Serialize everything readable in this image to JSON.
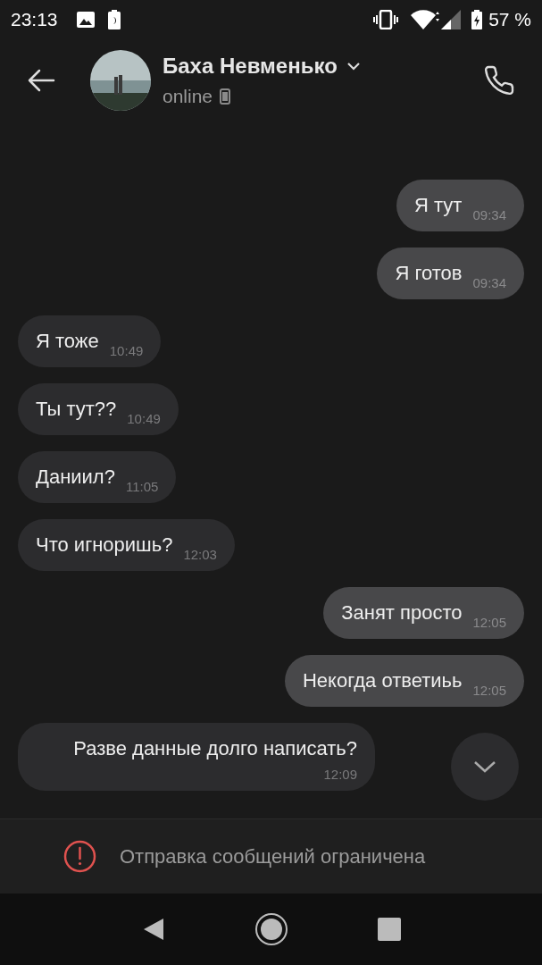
{
  "status_bar": {
    "time": "23:13",
    "battery": "57 %"
  },
  "header": {
    "name": "Баха Невменько",
    "status": "online"
  },
  "messages": [
    {
      "kind": "outgoing",
      "text": "Я тут",
      "time": "09:34"
    },
    {
      "kind": "outgoing",
      "text": "Я готов",
      "time": "09:34"
    },
    {
      "kind": "incoming",
      "text": "Я тоже",
      "time": "10:49"
    },
    {
      "kind": "incoming",
      "text": "Ты тут??",
      "time": "10:49"
    },
    {
      "kind": "incoming",
      "text": "Даниил?",
      "time": "11:05"
    },
    {
      "kind": "incoming",
      "text": "Что игноришь?",
      "time": "12:03"
    },
    {
      "kind": "outgoing",
      "text": "Занят просто",
      "time": "12:05"
    },
    {
      "kind": "outgoing",
      "text": "Некогда ответиьь",
      "time": "12:05"
    },
    {
      "kind": "incoming",
      "text": "Разве данные долго написать?",
      "time": "12:09"
    }
  ],
  "banner": {
    "text": "Отправка сообщений ограничена"
  }
}
